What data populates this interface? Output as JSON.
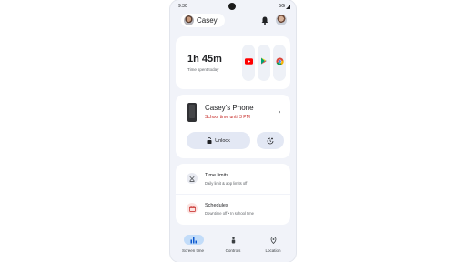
{
  "status_bar": {
    "time": "9:30",
    "network": "5G"
  },
  "header": {
    "profile_name": "Casey"
  },
  "screen_time_card": {
    "total_time": "1h 45m",
    "caption": "Time spent today",
    "top_apps": [
      "youtube-icon",
      "play-store-icon",
      "chrome-icon"
    ]
  },
  "device_card": {
    "device_name": "Casey's Phone",
    "status": "School time until 3 PM",
    "unlock_label": "Unlock",
    "status_color": "#c5221f"
  },
  "settings_list": [
    {
      "title": "Time limits",
      "subtitle": "Daily limit & app limits off"
    },
    {
      "title": "Schedules",
      "subtitle": "Downtime off • In school time"
    }
  ],
  "bottom_nav": [
    {
      "label": "Screen time",
      "active": true
    },
    {
      "label": "Controls",
      "active": false
    },
    {
      "label": "Location",
      "active": false
    }
  ],
  "colors": {
    "accent": "#c2dcf9",
    "background": "#f1f3f9",
    "button": "#e3e8f4"
  }
}
